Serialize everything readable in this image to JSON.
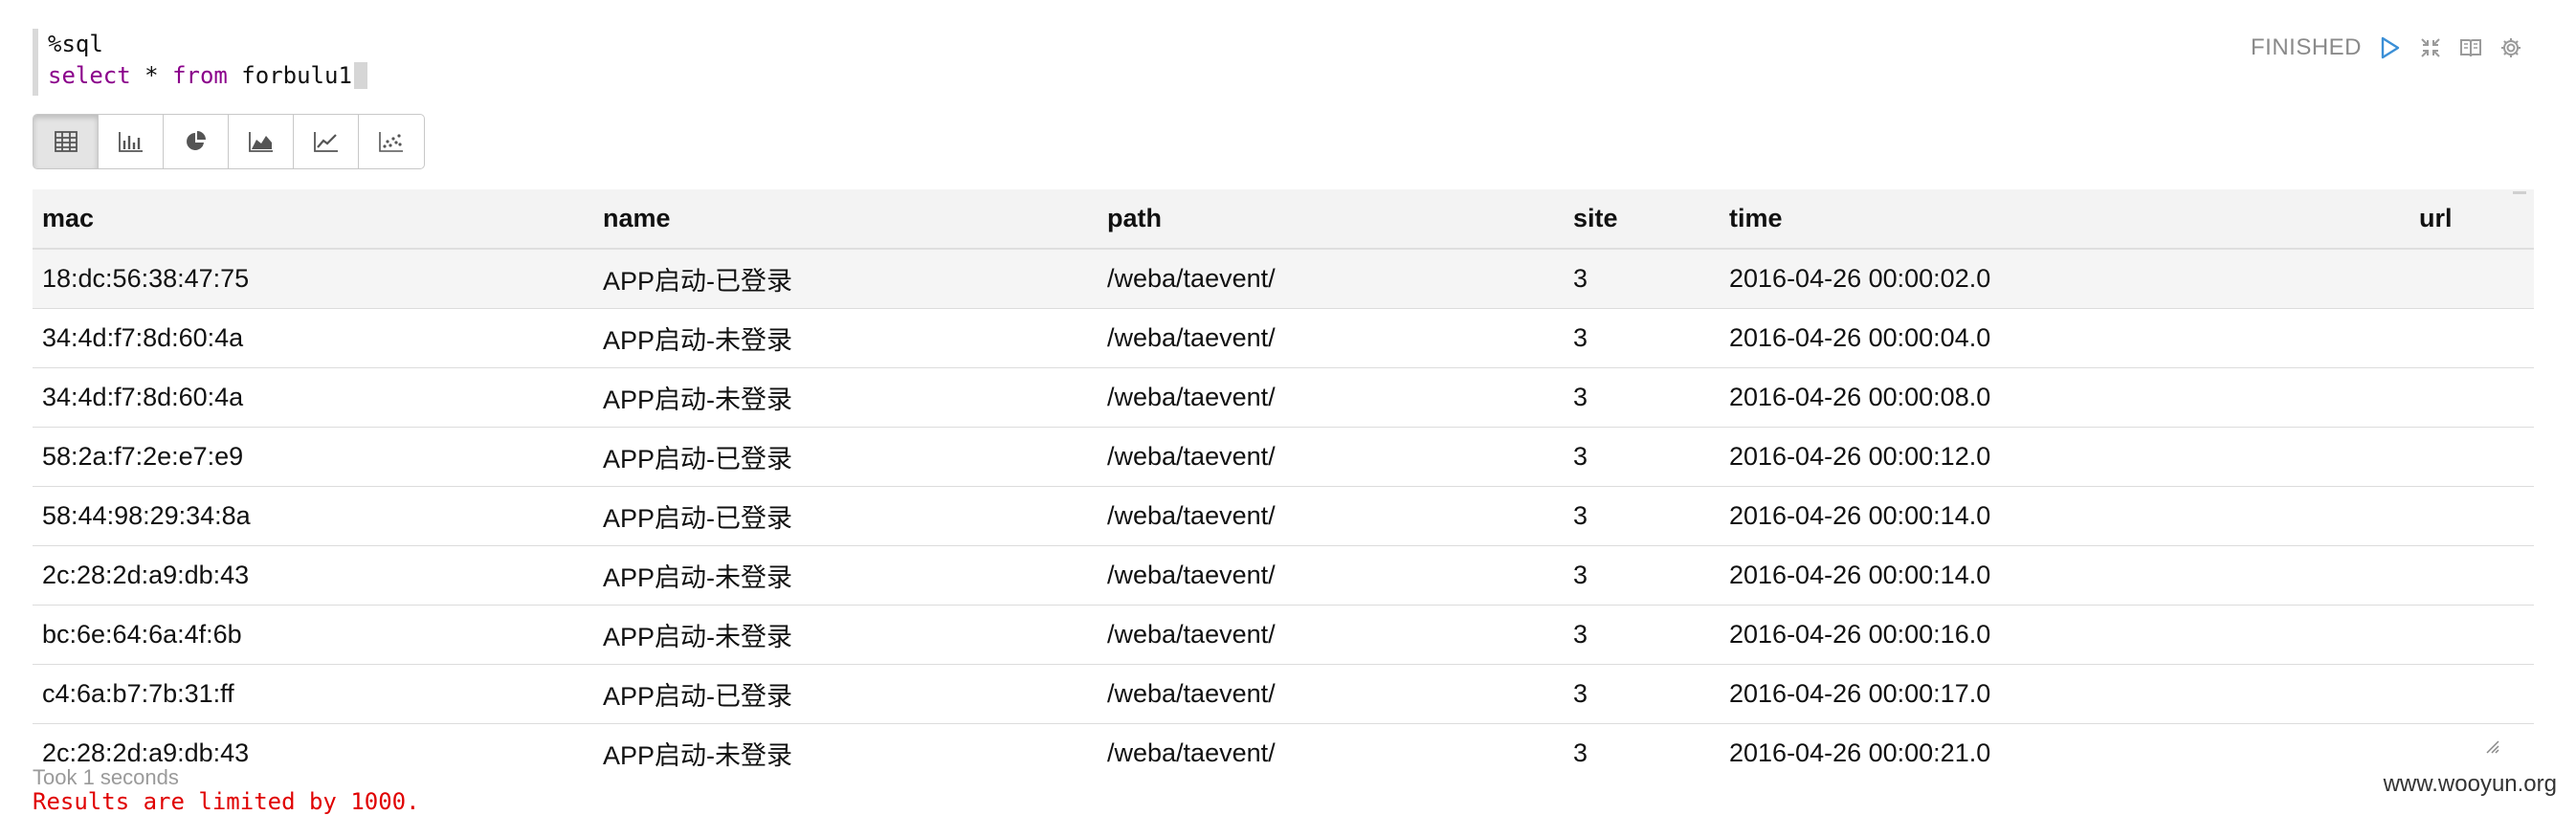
{
  "editor": {
    "line1": "%sql",
    "line2_kw1": "select",
    "line2_star": " * ",
    "line2_kw2": "from",
    "line2_table": " forbulu1"
  },
  "status": {
    "label": "FINISHED",
    "icons": [
      "play-icon",
      "collapse-icon",
      "book-icon",
      "gear-icon"
    ]
  },
  "viz_buttons": [
    {
      "icon": "table-icon",
      "active": true
    },
    {
      "icon": "bar-chart-icon",
      "active": false
    },
    {
      "icon": "pie-chart-icon",
      "active": false
    },
    {
      "icon": "area-chart-icon",
      "active": false
    },
    {
      "icon": "line-chart-icon",
      "active": false
    },
    {
      "icon": "scatter-chart-icon",
      "active": false
    }
  ],
  "table": {
    "columns": [
      "mac",
      "name",
      "path",
      "site",
      "time",
      "url"
    ],
    "rows": [
      [
        "18:dc:56:38:47:75",
        "APP启动-已登录",
        "/weba/taevent/",
        "3",
        "2016-04-26 00:00:02.0",
        ""
      ],
      [
        "34:4d:f7:8d:60:4a",
        "APP启动-未登录",
        "/weba/taevent/",
        "3",
        "2016-04-26 00:00:04.0",
        ""
      ],
      [
        "34:4d:f7:8d:60:4a",
        "APP启动-未登录",
        "/weba/taevent/",
        "3",
        "2016-04-26 00:00:08.0",
        ""
      ],
      [
        "58:2a:f7:2e:e7:e9",
        "APP启动-已登录",
        "/weba/taevent/",
        "3",
        "2016-04-26 00:00:12.0",
        ""
      ],
      [
        "58:44:98:29:34:8a",
        "APP启动-已登录",
        "/weba/taevent/",
        "3",
        "2016-04-26 00:00:14.0",
        ""
      ],
      [
        "2c:28:2d:a9:db:43",
        "APP启动-未登录",
        "/weba/taevent/",
        "3",
        "2016-04-26 00:00:14.0",
        ""
      ],
      [
        "bc:6e:64:6a:4f:6b",
        "APP启动-未登录",
        "/weba/taevent/",
        "3",
        "2016-04-26 00:00:16.0",
        ""
      ],
      [
        "c4:6a:b7:7b:31:ff",
        "APP启动-已登录",
        "/weba/taevent/",
        "3",
        "2016-04-26 00:00:17.0",
        ""
      ],
      [
        "2c:28:2d:a9:db:43",
        "APP启动-未登录",
        "/weba/taevent/",
        "3",
        "2016-04-26 00:00:21.0",
        ""
      ]
    ]
  },
  "footer": {
    "took": "Took 1 seconds",
    "limit": "Results are limited by 1000.",
    "watermark": "www.wooyun.org"
  },
  "colors": {
    "keyword": "#8b008b",
    "status_text": "#8a8a8a",
    "play_icon": "#3b8fd6",
    "limit_text": "#e00000"
  }
}
